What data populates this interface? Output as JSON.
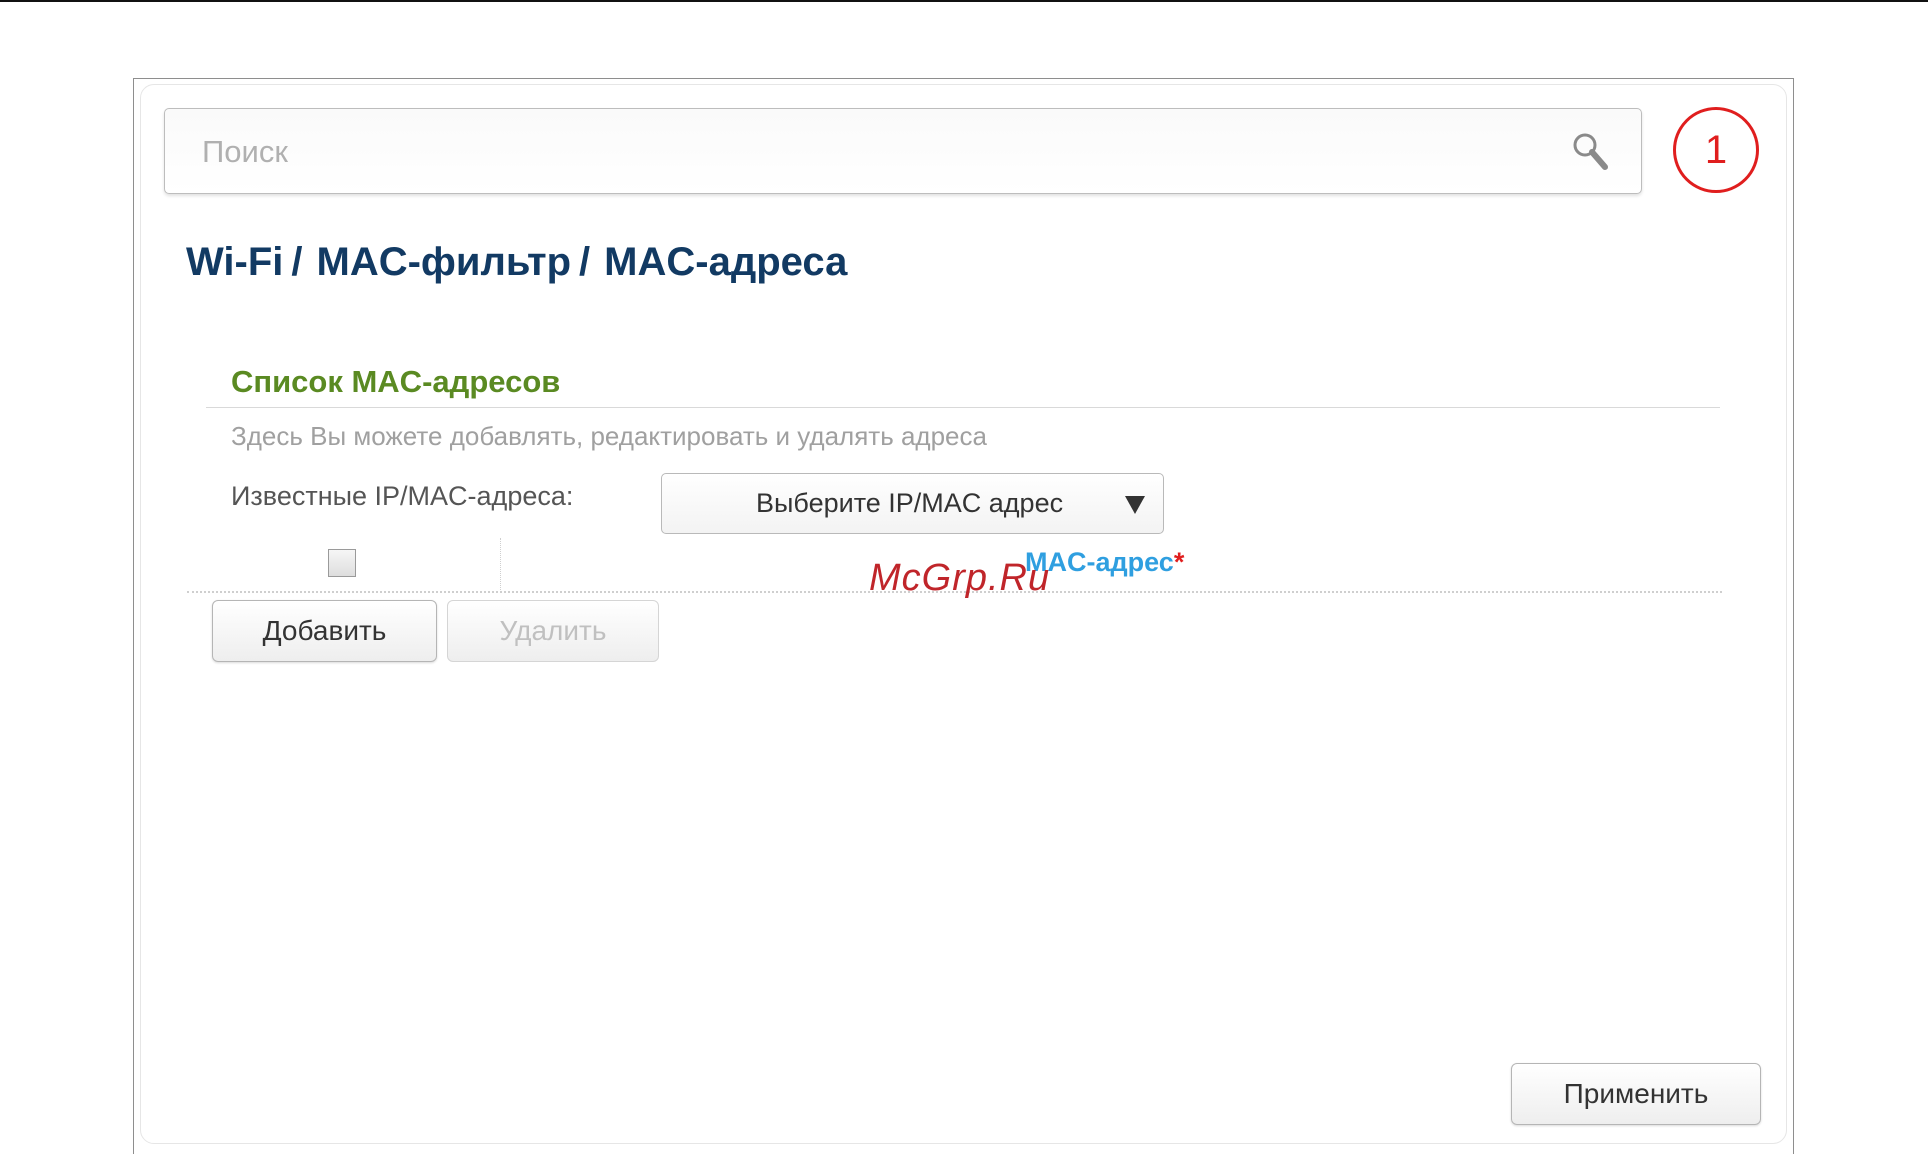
{
  "search": {
    "placeholder": "Поиск"
  },
  "notifications": {
    "count": "1"
  },
  "breadcrumb": [
    "Wi-Fi",
    "MAC-фильтр",
    "MAC-адреса"
  ],
  "breadcrumb_separator": "/",
  "section": {
    "title": "Список MAC-адресов",
    "description": "Здесь Вы можете добавлять, редактировать и удалять адреса"
  },
  "known_addresses": {
    "label": "Известные IP/MAC-адреса:",
    "selected": "Выберите IP/MAC адрес"
  },
  "table": {
    "select_all_checked": false,
    "column_header": "MAC-адрес",
    "required_marker": "*"
  },
  "buttons": {
    "add": "Добавить",
    "delete": "Удалить",
    "apply": "Применить"
  },
  "watermark": "McGrp.Ru",
  "colors": {
    "accent": "#2f9fe0",
    "section_title": "#5a8a22",
    "breadcrumb": "#123a63",
    "badge": "#e01e1e"
  }
}
